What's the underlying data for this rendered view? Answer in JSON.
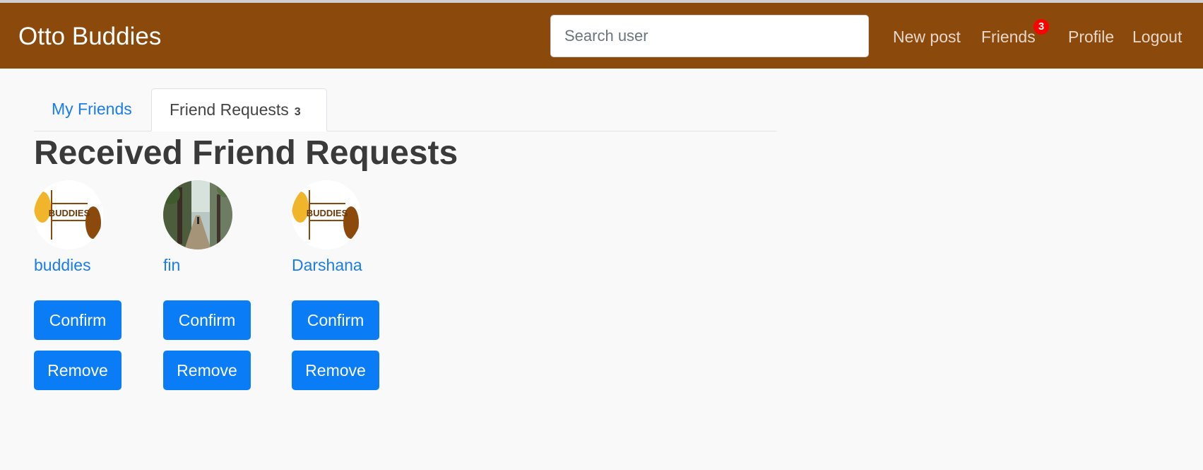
{
  "navbar": {
    "brand": "Otto Buddies",
    "search_placeholder": "Search user",
    "links": {
      "new_post": "New post",
      "friends": "Friends",
      "friends_badge": "3",
      "profile": "Profile",
      "logout": "Logout"
    }
  },
  "tabs": {
    "my_friends": "My Friends",
    "friend_requests": "Friend Requests",
    "friend_requests_count": "3"
  },
  "heading": "Received Friend Requests",
  "requests": [
    {
      "name": "buddies",
      "avatar": "buddies-logo",
      "confirm_label": "Confirm",
      "remove_label": "Remove"
    },
    {
      "name": "fin",
      "avatar": "street-photo",
      "confirm_label": "Confirm",
      "remove_label": "Remove"
    },
    {
      "name": "Darshana",
      "avatar": "buddies-logo",
      "confirm_label": "Confirm",
      "remove_label": "Remove"
    }
  ],
  "logo_text": "BUDDIES",
  "colors": {
    "navbar": "#8b4a0b",
    "primary": "#0a7cf6",
    "link": "#1a7cef",
    "badge": "#ff0000"
  }
}
